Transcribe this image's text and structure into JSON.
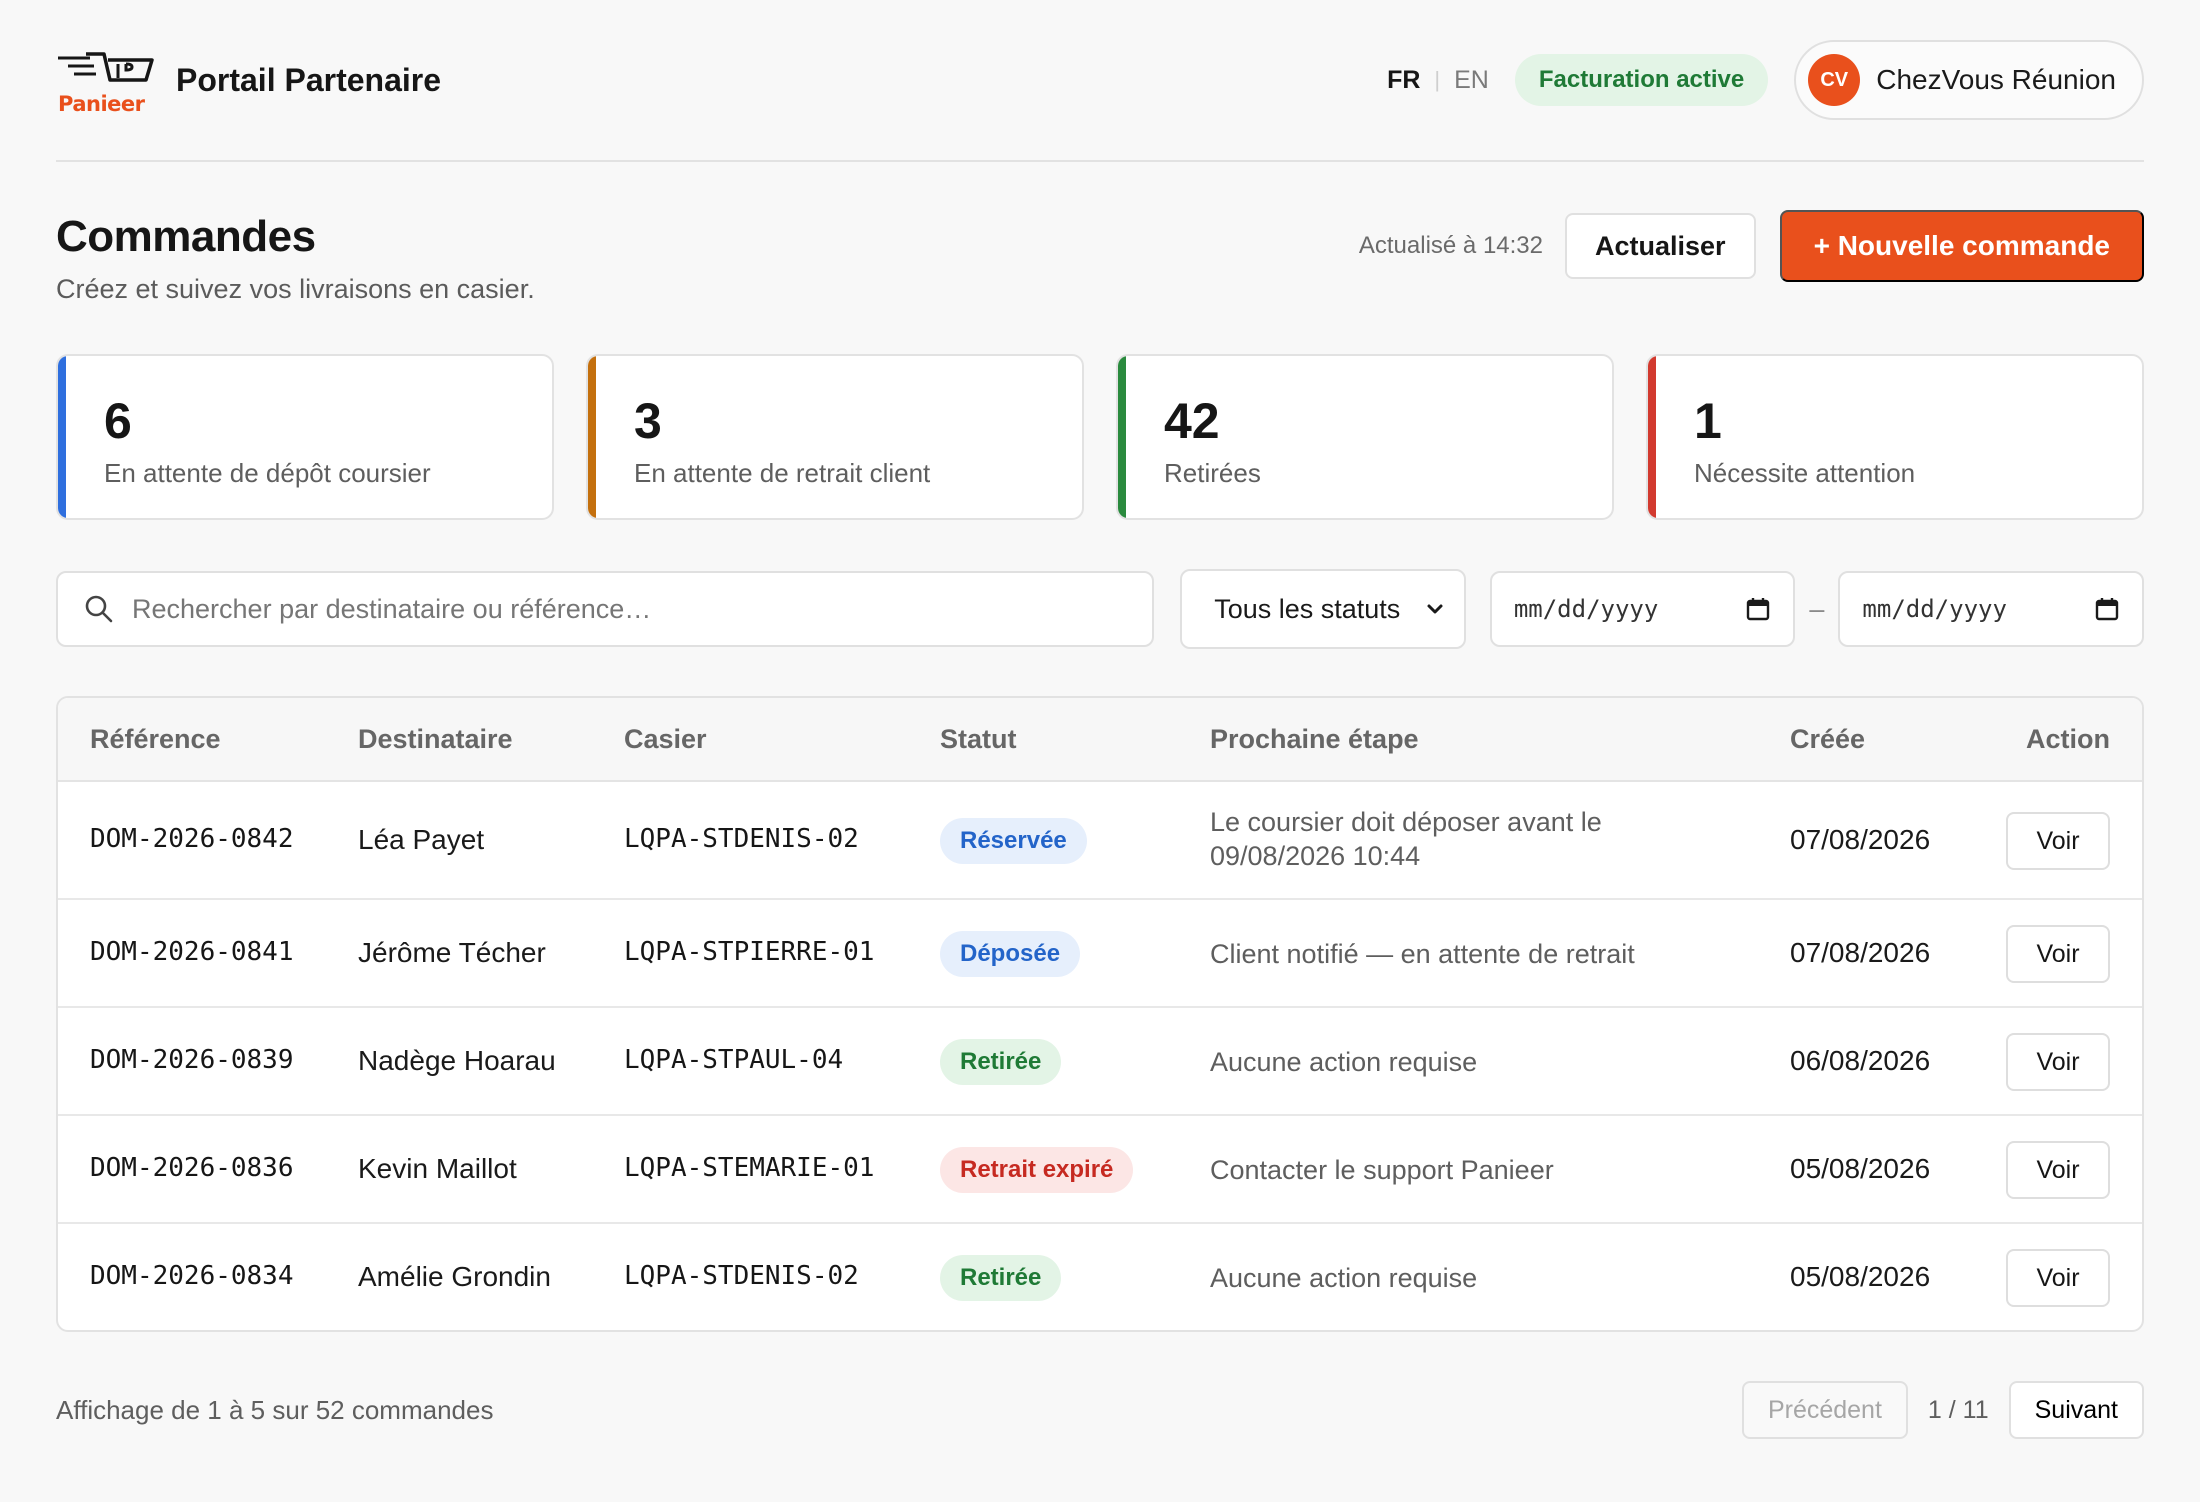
{
  "header": {
    "logo_text": "Panieer",
    "portal_title": "Portail Partenaire",
    "lang_fr": "FR",
    "lang_sep": "|",
    "lang_en": "EN",
    "billing_badge": "Facturation active",
    "account_initials": "CV",
    "account_name": "ChezVous Réunion"
  },
  "page": {
    "title": "Commandes",
    "subtitle": "Créez et suivez vos livraisons en casier.",
    "updated": "Actualisé à 14:32",
    "refresh_label": "Actualiser",
    "new_order_label": "+ Nouvelle commande"
  },
  "stats": [
    {
      "value": "6",
      "label": "En attente de dépôt coursier",
      "color": "#2f6fde"
    },
    {
      "value": "3",
      "label": "En attente de retrait client",
      "color": "#c4700e"
    },
    {
      "value": "42",
      "label": "Retirées",
      "color": "#2a8a3e"
    },
    {
      "value": "1",
      "label": "Nécessite attention",
      "color": "#d23a2f"
    }
  ],
  "filters": {
    "search_placeholder": "Rechercher par destinataire ou référence…",
    "status_selected": "Tous les statuts",
    "date_from_placeholder": "mm/dd/yyyy",
    "date_to_placeholder": "mm/dd/yyyy",
    "range_sep": "–"
  },
  "table": {
    "columns": [
      "Référence",
      "Destinataire",
      "Casier",
      "Statut",
      "Prochaine étape",
      "Créée",
      "Action"
    ],
    "rows": [
      {
        "ref": "DOM-2026-0842",
        "recipient": "Léa Payet",
        "locker": "LQPA-STDENIS-02",
        "status": "Réservée",
        "status_kind": "blue",
        "next": "Le coursier doit déposer avant le",
        "next2": "09/08/2026 10:44",
        "created": "07/08/2026",
        "action": "Voir"
      },
      {
        "ref": "DOM-2026-0841",
        "recipient": "Jérôme Técher",
        "locker": "LQPA-STPIERRE-01",
        "status": "Déposée",
        "status_kind": "blue",
        "next": "Client notifié — en attente de retrait",
        "next2": "",
        "created": "07/08/2026",
        "action": "Voir"
      },
      {
        "ref": "DOM-2026-0839",
        "recipient": "Nadège Hoarau",
        "locker": "LQPA-STPAUL-04",
        "status": "Retirée",
        "status_kind": "green",
        "next": "Aucune action requise",
        "next2": "",
        "created": "06/08/2026",
        "action": "Voir"
      },
      {
        "ref": "DOM-2026-0836",
        "recipient": "Kevin Maillot",
        "locker": "LQPA-STEMARIE-01",
        "status": "Retrait expiré",
        "status_kind": "red",
        "next": "Contacter le support Panieer",
        "next2": "",
        "created": "05/08/2026",
        "action": "Voir"
      },
      {
        "ref": "DOM-2026-0834",
        "recipient": "Amélie Grondin",
        "locker": "LQPA-STDENIS-02",
        "status": "Retirée",
        "status_kind": "green",
        "next": "Aucune action requise",
        "next2": "",
        "created": "05/08/2026",
        "action": "Voir"
      }
    ]
  },
  "footer": {
    "count": "Affichage de 1 à 5 sur 52 commandes",
    "prev_label": "Précédent",
    "page_info": "1 / 11",
    "next_label": "Suivant"
  },
  "colors": {
    "accent": "#e9501c",
    "badge_blue_bg": "#e6effc",
    "badge_blue_fg": "#2364c9",
    "badge_green_bg": "#e3f4e6",
    "badge_green_fg": "#1f7a36",
    "badge_red_bg": "#fce6e5",
    "badge_red_fg": "#c62a21"
  }
}
